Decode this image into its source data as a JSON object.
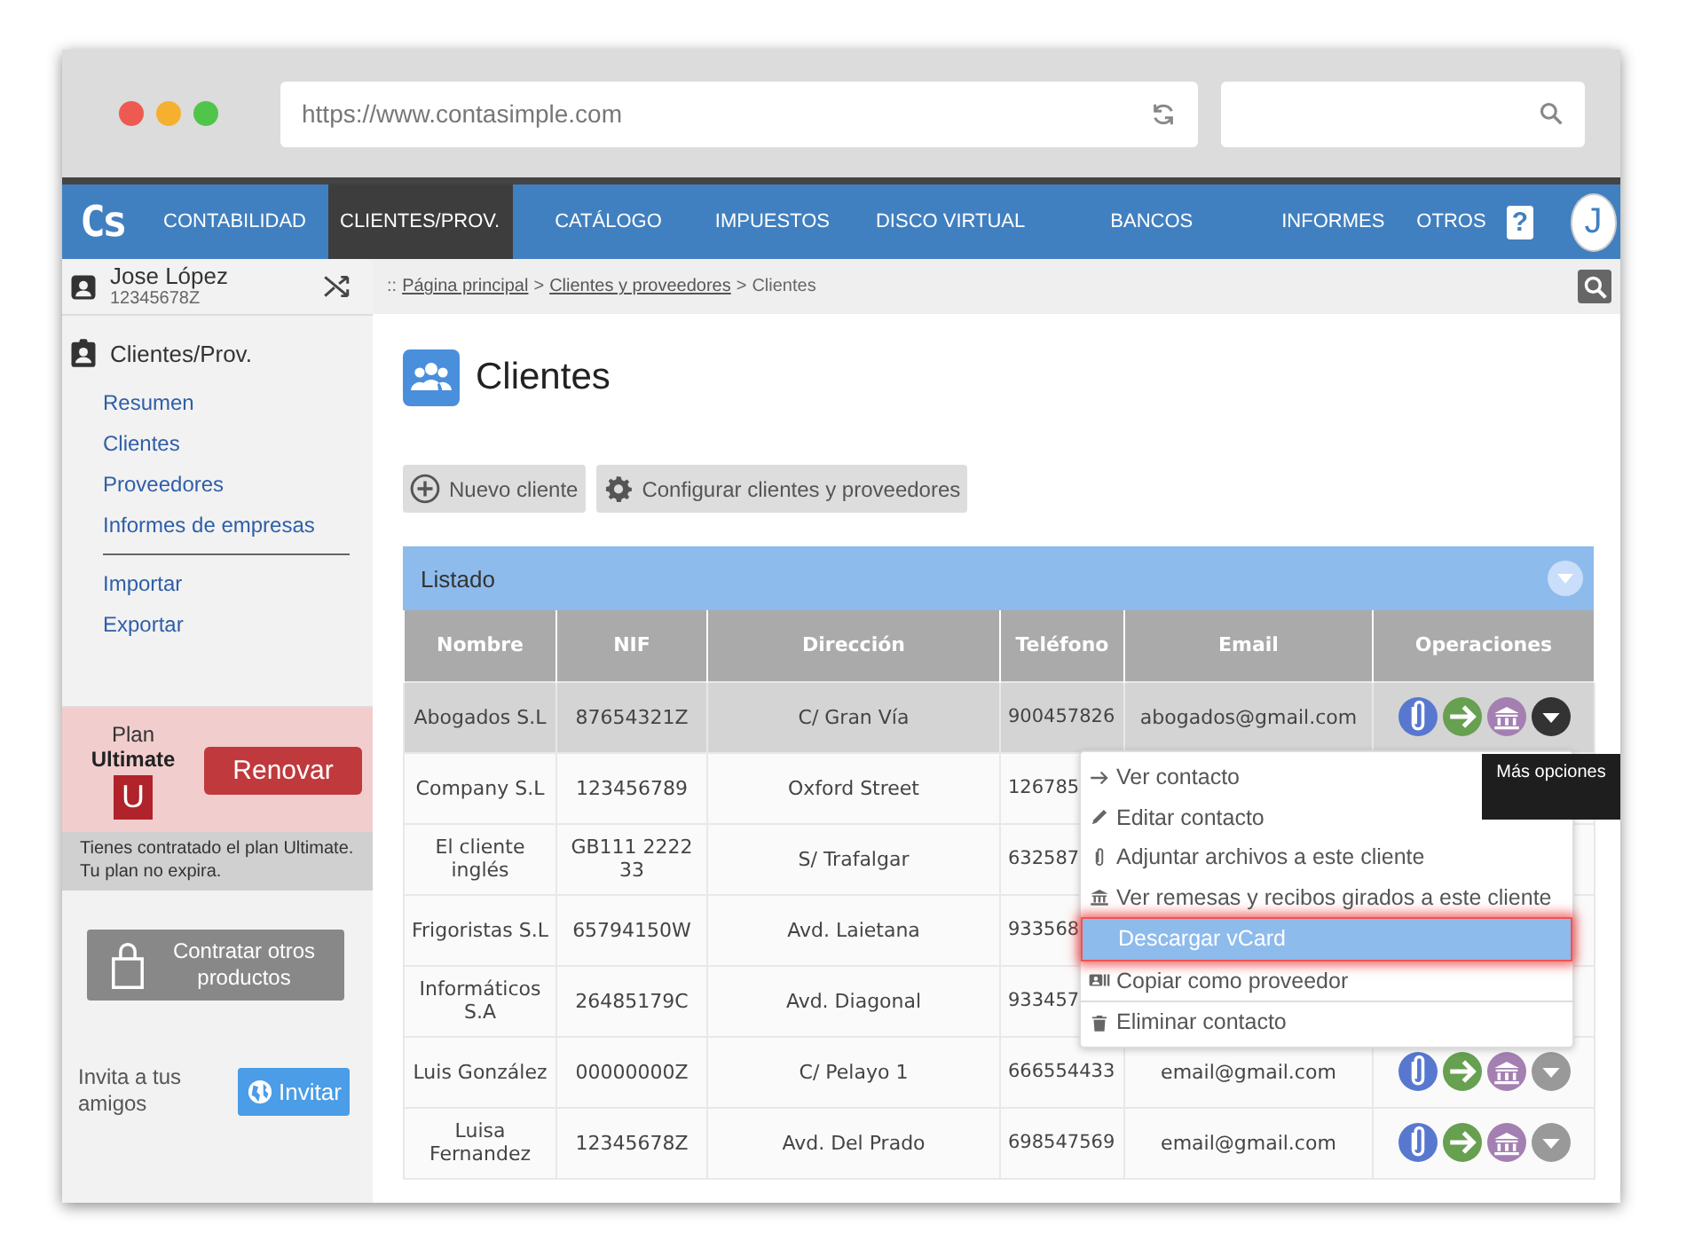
{
  "browser": {
    "url": "https://www.contasimple.com"
  },
  "nav": {
    "logo": "Cs",
    "items": [
      {
        "label": "CONTABILIDAD",
        "selected": false
      },
      {
        "label": "CLIENTES/PROV.",
        "selected": true
      },
      {
        "label": "CATÁLOGO",
        "selected": false
      },
      {
        "label": "IMPUESTOS",
        "selected": false
      },
      {
        "label": "DISCO VIRTUAL",
        "selected": false
      },
      {
        "label": "BANCOS",
        "selected": false
      },
      {
        "label": "INFORMES",
        "selected": false
      },
      {
        "label": "OTROS",
        "selected": false
      }
    ],
    "help": "?",
    "avatar": "J"
  },
  "user": {
    "name": "Jose López",
    "id": "12345678Z"
  },
  "sidebar": {
    "section": "Clientes/Prov.",
    "groups": [
      [
        "Resumen",
        "Clientes",
        "Proveedores",
        "Informes de empresas"
      ],
      [
        "Importar",
        "Exportar"
      ]
    ]
  },
  "plan": {
    "label": "Plan",
    "name": "Ultimate",
    "badge": "U",
    "button": "Renovar",
    "note": "Tienes contratado el plan Ultimate. Tu plan no expira."
  },
  "contract_button": "Contratar otros productos",
  "invite": {
    "text": "Invita a tus amigos",
    "button": "Invitar"
  },
  "breadcrumb": [
    {
      "kind": "sep",
      "text": "::"
    },
    {
      "kind": "link",
      "text": "Página principal"
    },
    {
      "kind": "sep",
      "text": ">"
    },
    {
      "kind": "link",
      "text": "Clientes y proveedores"
    },
    {
      "kind": "sep",
      "text": ">"
    },
    {
      "kind": "text",
      "text": "Clientes"
    }
  ],
  "page_title": "Clientes",
  "actions": [
    "Nuevo cliente",
    "Configurar clientes y proveedores"
  ],
  "panel": {
    "title": "Listado",
    "columns": [
      "Nombre",
      "NIF",
      "Dirección",
      "Teléfono",
      "Email",
      "Operaciones"
    ],
    "rows": [
      {
        "cells": [
          "Abogados S.L",
          "87654321Z",
          "C/ Gran Vía",
          "900457826",
          "abogados@gmail.com"
        ],
        "selected": true,
        "operations": true
      },
      {
        "cells": [
          "Company S.L",
          "123456789",
          "Oxford Street",
          "126785"
        ],
        "selected": false
      },
      {
        "cells": [
          "El cliente inglés",
          "GB111 2222 33",
          "S/ Trafalgar",
          "632587"
        ],
        "selected": false
      },
      {
        "cells": [
          "Frigoristas S.L",
          "65794150W",
          "Avd. Laietana",
          "933568"
        ],
        "selected": false
      },
      {
        "cells": [
          "Informáticos S.A",
          "26485179C",
          "Avd. Diagonal",
          "933457"
        ],
        "selected": false
      },
      {
        "cells": [
          "Luis González",
          "00000000Z",
          "C/ Pelayo 1",
          "666554433",
          "email@gmail.com"
        ],
        "selected": false,
        "operations": true
      },
      {
        "cells": [
          "Luisa Fernandez",
          "12345678Z",
          "Avd. Del Prado",
          "698547569",
          "email@gmail.com"
        ],
        "selected": false,
        "operations": true
      }
    ]
  },
  "menu": {
    "items": [
      {
        "label": "Ver contacto",
        "selected": false
      },
      {
        "label": "Editar contacto",
        "selected": false
      },
      {
        "label": "Adjuntar archivos a este cliente",
        "selected": false
      },
      {
        "label": "Ver remesas y recibos girados a este cliente",
        "selected": false
      },
      {
        "label": "Descargar vCard",
        "selected": true
      },
      {
        "label": "Copiar como proveedor",
        "selected": false
      },
      {
        "label": "Eliminar contacto",
        "selected": false
      }
    ]
  },
  "tooltip": "Más opciones"
}
